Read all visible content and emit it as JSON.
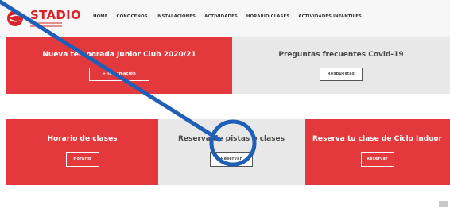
{
  "brand": {
    "name": "STADIO",
    "color": "#d8232a"
  },
  "nav": {
    "items": [
      "HOME",
      "CONÓCENOS",
      "INSTALACIONES",
      "ACTIVIDADES",
      "HORARIO CLASES",
      "ACTIVIDADES INFANTILES"
    ]
  },
  "panels": {
    "junior": {
      "title": "Nueva temporada Junior Club 2020/21",
      "button": "+ Información"
    },
    "covid": {
      "title": "Preguntas frecuentes Covid-19",
      "button": "Respuestas"
    },
    "horario": {
      "title": "Horario de clases",
      "button": "Horario"
    },
    "reserva": {
      "title": "Reserva de pistas o clases",
      "button": "Reservar"
    },
    "ciclo": {
      "title": "Reserva tu clase de Ciclo Indoor",
      "button": "Reservar"
    }
  },
  "colors": {
    "accent_red": "#e3393c",
    "gray_panel": "#e8e8e8",
    "annotation_blue": "#1f5fb8"
  },
  "icons": {
    "logo": "stadio-logo-icon",
    "annotation": "pointer-line-and-circle"
  }
}
